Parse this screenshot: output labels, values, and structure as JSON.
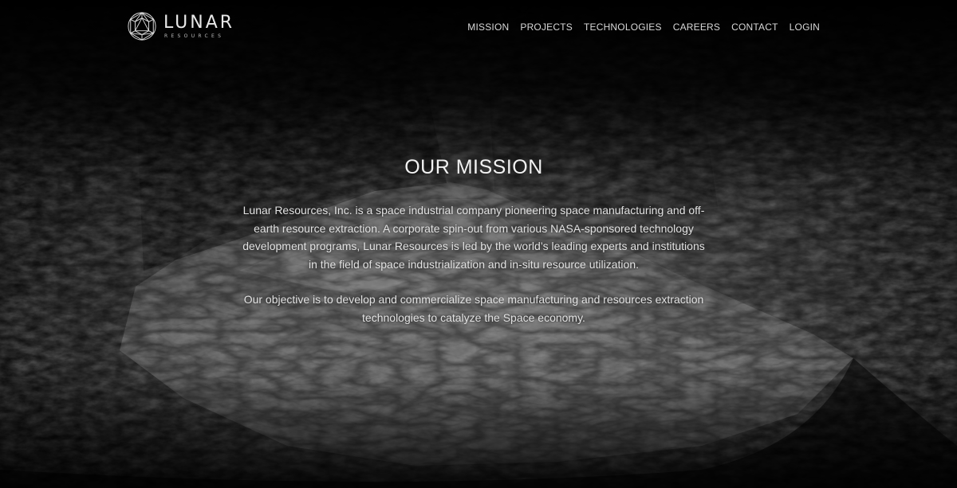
{
  "brand": {
    "name": "LUNAR",
    "tagline": "RESOURCES",
    "logo_icon": "geodesic-sphere-icon"
  },
  "nav": {
    "items": [
      {
        "label": "MISSION"
      },
      {
        "label": "PROJECTS"
      },
      {
        "label": "TECHNOLOGIES"
      },
      {
        "label": "CAREERS"
      },
      {
        "label": "CONTACT"
      },
      {
        "label": "LOGIN"
      }
    ]
  },
  "mission": {
    "title": "OUR MISSION",
    "paragraph_1": "Lunar Resources, Inc. is a space industrial company pioneering space manufacturing and off-earth resource extraction. A corporate spin-out from various NASA-sponsored technology development programs, Lunar Resources is led by the world’s leading experts and institutions in the field of space industrialization and in-situ resource utilization.",
    "paragraph_2": "Our objective is to develop and commercialize space manufacturing and resources extraction technologies to catalyze the Space economy."
  },
  "colors": {
    "background": "#050505",
    "text": "#e6e6e6",
    "nav_text": "#d8d8d8"
  }
}
